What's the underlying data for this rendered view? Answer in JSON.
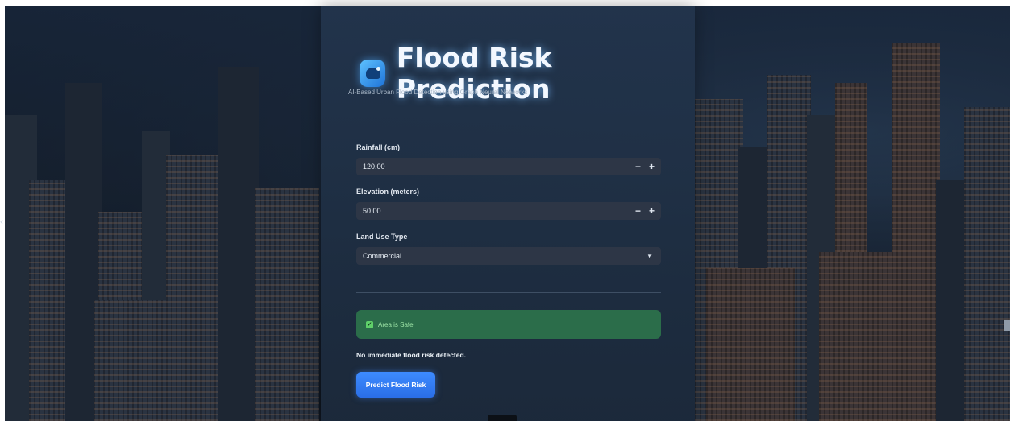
{
  "app": {
    "title": "Flood Risk Prediction",
    "subtitle": "AI-Based Urban Flood Detection using Graph Neural Networks"
  },
  "form": {
    "rainfall": {
      "label": "Rainfall (cm)",
      "value": "120.00",
      "minus": "−",
      "plus": "+"
    },
    "elevation": {
      "label": "Elevation (meters)",
      "value": "50.00",
      "minus": "−",
      "plus": "+"
    },
    "land_use": {
      "label": "Land Use Type",
      "selected": "Commercial"
    }
  },
  "result": {
    "alert_text": "Area is Safe",
    "status_text": "No immediate flood risk detected."
  },
  "actions": {
    "predict_label": "Predict Flood Risk"
  },
  "icons": {
    "logo": "water-wave-icon",
    "alert": "check-icon",
    "select": "chevron-down-icon",
    "nav": "chevron-left-icon"
  },
  "colors": {
    "accent": "#2f7bf2",
    "success_bg": "#2b6d4a",
    "panel": "#22344c"
  }
}
